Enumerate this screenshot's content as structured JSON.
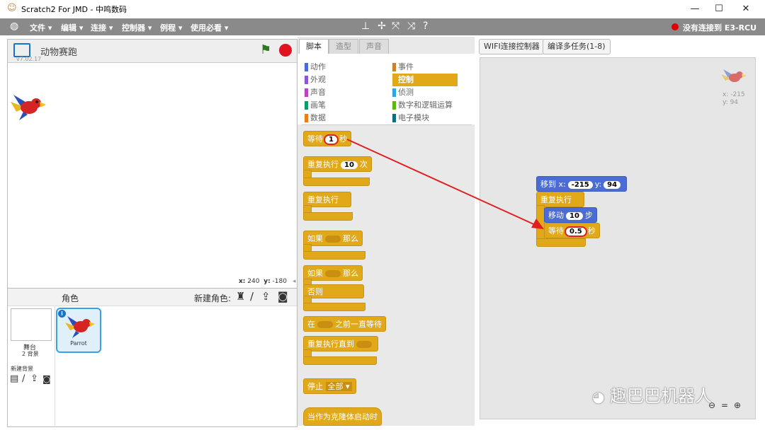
{
  "window": {
    "title": "Scratch2 For JMD - 中鸣数码"
  },
  "menu": {
    "items": [
      "文件 ▾",
      "编辑 ▾",
      "连接 ▾",
      "控制器 ▾",
      "例程 ▾",
      "使用必看 ▾"
    ],
    "connection_status": "没有连接到 E3-RCU"
  },
  "stage": {
    "title": "动物赛跑",
    "version": "v7.02.17",
    "x_label": "x:",
    "x_value": "240",
    "y_label": "y:",
    "y_value": "-180"
  },
  "sprites": {
    "header": "角色",
    "new_sprite_label": "新建角色:",
    "stage_label": "舞台",
    "stage_backdrops": "2 背景",
    "new_backdrop_label": "新建背景",
    "sprite_name": "Parrot"
  },
  "tabs": [
    "脚本",
    "造型",
    "声音"
  ],
  "categories": {
    "left": [
      "动作",
      "外观",
      "声音",
      "画笔",
      "数据"
    ],
    "right": [
      "事件",
      "控制",
      "侦测",
      "数字和逻辑运算",
      "电子模块"
    ],
    "left_colors": [
      "#4a6cd4",
      "#8a55d7",
      "#bb42c3",
      "#0e9a6c",
      "#ee7d16"
    ],
    "right_colors": [
      "#c88330",
      "#e1a91a",
      "#2ca5e2",
      "#5cb712",
      "#0f6e7e"
    ]
  },
  "palette": {
    "wait": {
      "pre": "等待",
      "val": "1",
      "post": "秒"
    },
    "repeat": {
      "pre": "重复执行",
      "val": "10",
      "post": "次"
    },
    "forever": "重复执行",
    "if_then": {
      "pre": "如果",
      "post": "那么"
    },
    "if_else": {
      "pre": "如果",
      "post": "那么",
      "else": "否则"
    },
    "wait_until": {
      "pre": "在",
      "post": "之前一直等待"
    },
    "repeat_until": "重复执行直到",
    "stop": {
      "pre": "停止",
      "val": "全部"
    },
    "clone_hat": "当作为克隆体启动时"
  },
  "toolbar": {
    "wifi": "WIFI连接控制器",
    "compile": "编译多任务(1-8)"
  },
  "script": {
    "goto": {
      "pre": "移到 x:",
      "x": "-215",
      "mid": "y:",
      "y": "94"
    },
    "forever": "重复执行",
    "move": {
      "pre": "移动",
      "val": "10",
      "post": "步"
    },
    "wait": {
      "pre": "等待",
      "val": "0.5",
      "post": "秒"
    }
  },
  "sprite_info": {
    "x": "x: -215",
    "y": "y: 94"
  },
  "watermark": "趣巴巴机器人"
}
